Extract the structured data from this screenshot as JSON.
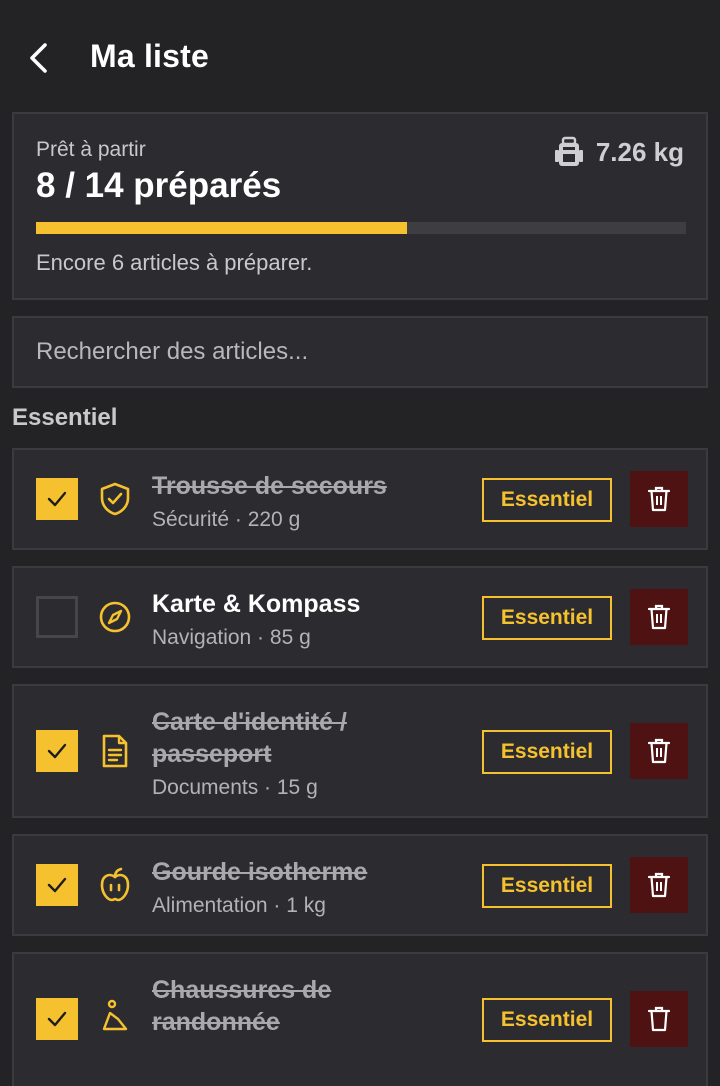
{
  "header": {
    "title": "Ma liste"
  },
  "summary": {
    "label": "Prêt à partir",
    "count_text": "8 / 14 préparés",
    "weight": "7.26 kg",
    "progress": 0.57,
    "remaining_text": "Encore 6 articles à préparer."
  },
  "search": {
    "placeholder": "Rechercher des articles..."
  },
  "section": {
    "title": "Essentiel"
  },
  "items": [
    {
      "name": "Trousse de secours",
      "meta": "Sécurité · 220 g",
      "badge": "Essentiel",
      "checked": true,
      "icon": "shield-check-icon"
    },
    {
      "name": "Karte & Kompass",
      "meta": "Navigation · 85 g",
      "badge": "Essentiel",
      "checked": false,
      "icon": "compass-icon"
    },
    {
      "name": "Carte d'identité / passeport",
      "meta": "Documents · 15 g",
      "badge": "Essentiel",
      "checked": true,
      "icon": "document-icon"
    },
    {
      "name": "Gourde isotherme",
      "meta": "Alimentation · 1 kg",
      "badge": "Essentiel",
      "checked": true,
      "icon": "apple-icon"
    },
    {
      "name": "Chaussures de randonnée",
      "meta": "",
      "badge": "Essentiel",
      "checked": true,
      "icon": "shoe-icon"
    }
  ],
  "colors": {
    "accent": "#f5c12e",
    "background": "#232326",
    "card": "#2c2c30",
    "danger": "#4e1212"
  }
}
